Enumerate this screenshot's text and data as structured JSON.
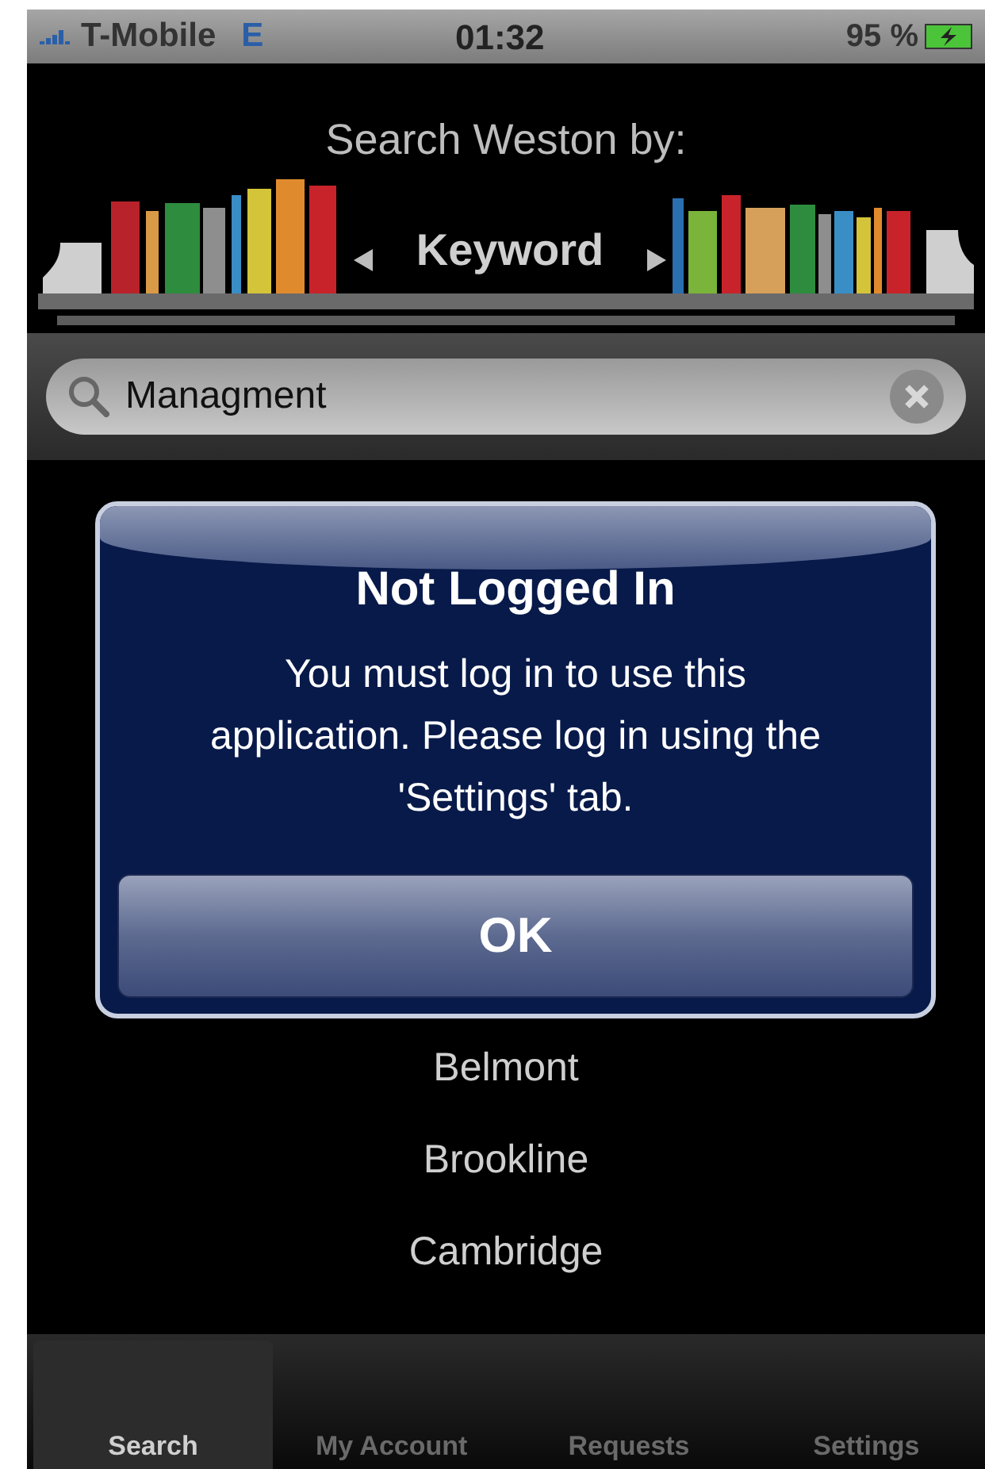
{
  "status_bar": {
    "carrier": "T-Mobile",
    "network": "E",
    "time": "01:32",
    "battery": "95 %"
  },
  "header": {
    "title": "Search Weston by:",
    "search_type": "Keyword"
  },
  "search": {
    "value": "Managment"
  },
  "libraries": [
    {
      "name": "Belmont"
    },
    {
      "name": "Brookline"
    },
    {
      "name": "Cambridge"
    }
  ],
  "alert": {
    "title": "Not Logged In",
    "message": "You must log in to use this application.  Please log in using the 'Settings' tab.",
    "button": "OK"
  },
  "tabs": [
    {
      "label": "Search",
      "selected": true
    },
    {
      "label": "My Account",
      "selected": false
    },
    {
      "label": "Requests",
      "selected": false
    },
    {
      "label": "Settings",
      "selected": false
    }
  ]
}
